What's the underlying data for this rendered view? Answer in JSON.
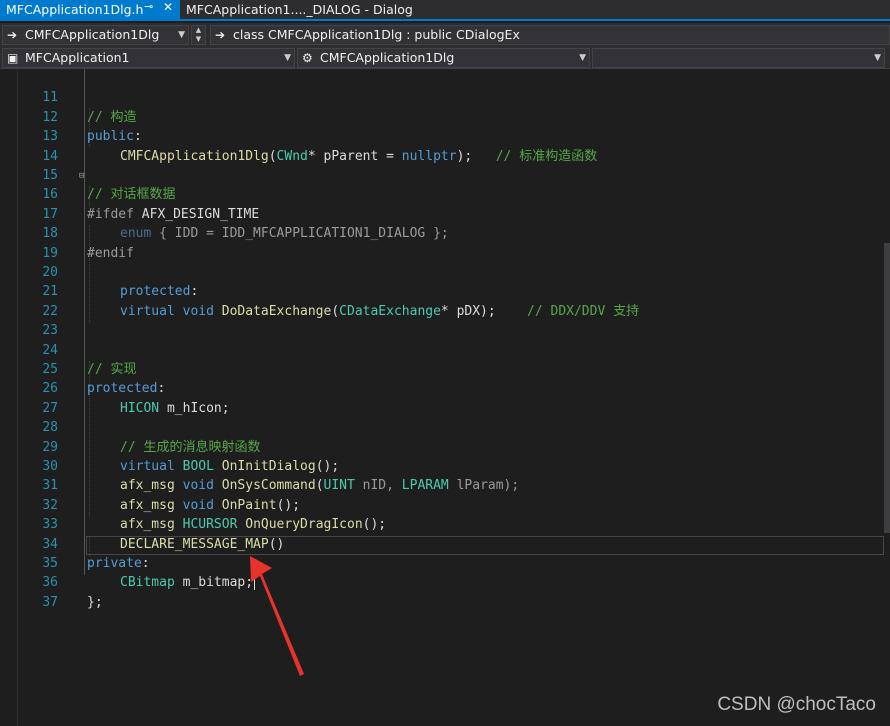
{
  "tabs": {
    "active": "MFCApplication1Dlg.h",
    "inactive": "MFCApplication1...._DIALOG - Dialog"
  },
  "nav": {
    "class_combo": "CMFCApplication1Dlg",
    "member_combo": "class CMFCApplication1Dlg : public CDialogEx",
    "project_combo": "MFCApplication1",
    "scope_combo": "CMFCApplication1Dlg",
    "third_combo": ""
  },
  "code": {
    "numbers": [
      "11",
      "12",
      "13",
      "14",
      "15",
      "16",
      "17",
      "18",
      "19",
      "20",
      "21",
      "22",
      "23",
      "24",
      "25",
      "26",
      "27",
      "28",
      "29",
      "30",
      "31",
      "32",
      "33",
      "34",
      "35",
      "36",
      "37"
    ],
    "l11": "// 构造",
    "l12_kw": "public",
    "l12_p": ":",
    "l13_fn": "CMFCApplication1Dlg",
    "l13_p1": "(",
    "l13_ty": "CWnd",
    "l13_p2": "* pParent = ",
    "l13_kw": "nullptr",
    "l13_p3": ");   ",
    "l13_cm": "// 标准构造函数",
    "l15": "// 对话框数据",
    "l16_pp": "#ifdef ",
    "l16_rest": "AFX_DESIGN_TIME",
    "l17_kw": "enum",
    "l17_rest": " { IDD = IDD_MFCAPPLICATION1_DIALOG };",
    "l18": "#endif",
    "l20_kw": "protected",
    "l20_p": ":",
    "l21_kw1": "virtual",
    "l21_kw2": "void",
    "l21_fn": "DoDataExchange",
    "l21_p1": "(",
    "l21_ty": "CDataExchange",
    "l21_p2": "* pDX);    ",
    "l21_cm": "// DDX/DDV 支持",
    "l24": "// 实现",
    "l25_kw": "protected",
    "l25_p": ":",
    "l26_ty": "HICON",
    "l26_rest": " m_hIcon;",
    "l28": "// 生成的消息映射函数",
    "l29_kw": "virtual",
    "l29_ty": "BOOL",
    "l29_fn": "OnInitDialog",
    "l29_p": "();",
    "l30_mac": "afx_msg",
    "l30_kw": "void",
    "l30_fn": "OnSysCommand",
    "l30_p1": "(",
    "l30_ty1": "UINT",
    "l30_p2": " nID, ",
    "l30_ty2": "LPARAM",
    "l30_p3": " lParam);",
    "l31_mac": "afx_msg",
    "l31_kw": "void",
    "l31_fn": "OnPaint",
    "l31_p": "();",
    "l32_mac": "afx_msg",
    "l32_ty": "HCURSOR",
    "l32_fn": "OnQueryDragIcon",
    "l32_p": "();",
    "l33_mac": "DECLARE_MESSAGE_MAP",
    "l33_p": "()",
    "l34_kw": "private",
    "l34_p": ":",
    "l35_ty": "CBitmap",
    "l35_rest": " m_bitmap;",
    "l36": "};"
  },
  "watermark": "CSDN @chocTaco",
  "colors": {
    "accent": "#007acc",
    "arrow": "#e8332c"
  }
}
